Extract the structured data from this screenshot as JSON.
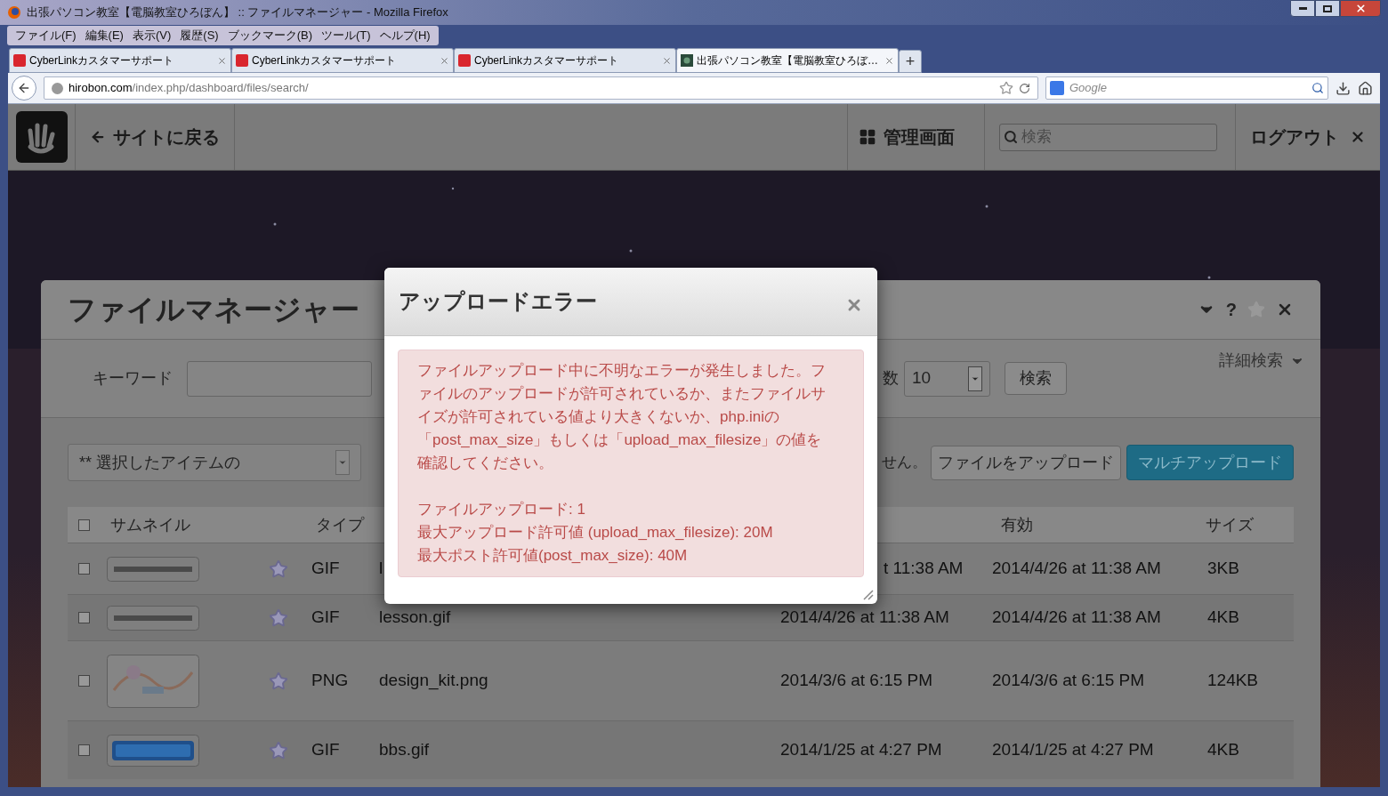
{
  "window": {
    "title": "出張パソコン教室【電脳教室ひろぼん】 :: ファイルマネージャー - Mozilla Firefox"
  },
  "menu": [
    "ファイル(F)",
    "編集(E)",
    "表示(V)",
    "履歴(S)",
    "ブックマーク(B)",
    "ツール(T)",
    "ヘルプ(H)"
  ],
  "tabs": [
    {
      "title": "CyberLinkカスタマーサポート",
      "selected": false,
      "kind": "cyberlink"
    },
    {
      "title": "CyberLinkカスタマーサポート",
      "selected": false,
      "kind": "cyberlink"
    },
    {
      "title": "CyberLinkカスタマーサポート",
      "selected": false,
      "kind": "cyberlink"
    },
    {
      "title": "出張パソコン教室【電脳教室ひろぼ…",
      "selected": true,
      "kind": "site"
    }
  ],
  "new_tab": "+",
  "address": {
    "host": "hirobon.com",
    "path": "/index.php/dashboard/files/search/"
  },
  "web_search": {
    "placeholder": "Google"
  },
  "toolbar": {
    "back": "サイトに戻る",
    "dashboard": "管理画面",
    "search_placeholder": "検索",
    "logout": "ログアウト"
  },
  "panel": {
    "title": "ファイルマネージャー",
    "help": "?",
    "keyword_label": "キーワード",
    "count_label": "数",
    "count_value": "10",
    "search_button": "検索",
    "advanced": "詳細検索",
    "bulk_select": "** 選択したアイテムの",
    "notice": "せん。",
    "upload_button": "ファイルをアップロード",
    "multi_upload_button": "マルチアップロード",
    "select_all_checked": false,
    "columns": {
      "thumbnail": "サムネイル",
      "type": "タイプ",
      "valid": "有効",
      "size": "サイズ"
    },
    "rows": [
      {
        "checked": false,
        "starred": false,
        "type": "GIF",
        "name": "l",
        "added": "t 11:38 AM",
        "added_partial": true,
        "valid": "2014/4/26 at 11:38 AM",
        "size": "3KB"
      },
      {
        "checked": false,
        "starred": false,
        "type": "GIF",
        "name": "lesson.gif",
        "added": "2014/4/26 at 11:38 AM",
        "added_partial": false,
        "valid": "2014/4/26 at 11:38 AM",
        "size": "4KB"
      },
      {
        "checked": false,
        "starred": false,
        "type": "PNG",
        "name": "design_kit.png",
        "added": "2014/3/6 at 6:15 PM",
        "added_partial": false,
        "valid": "2014/3/6 at 6:15 PM",
        "size": "124KB"
      },
      {
        "checked": false,
        "starred": false,
        "type": "GIF",
        "name": "bbs.gif",
        "added": "2014/1/25 at 4:27 PM",
        "added_partial": false,
        "valid": "2014/1/25 at 4:27 PM",
        "size": "4KB"
      }
    ]
  },
  "modal": {
    "title": "アップロードエラー",
    "message": "ファイルアップロード中に不明なエラーが発生しました。ファイルのアップロードが許可されているか、またファイルサイズが許可されている値より大きくないか、php.iniの「post_max_size」もしくは「upload_max_filesize」の値を確認してください。",
    "details": [
      "ファイルアップロード: 1",
      "最大アップロード許可値 (upload_max_filesize): 20M",
      "最大ポスト許可値(post_max_size): 40M"
    ]
  }
}
